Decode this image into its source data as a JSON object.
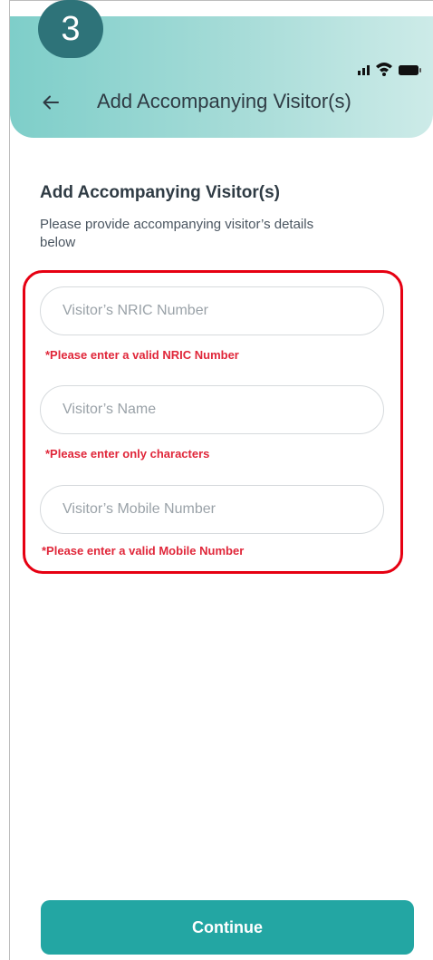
{
  "step": {
    "number": "3"
  },
  "status_bar": {
    "icons": [
      "signal-icon",
      "wifi-icon",
      "battery-icon"
    ]
  },
  "header": {
    "back_icon": "arrow-left-icon",
    "title": "Add Accompanying Visitor(s)"
  },
  "form": {
    "heading": "Add Accompanying Visitor(s)",
    "description": "Please provide accompanying visitor’s details below",
    "fields": [
      {
        "placeholder": "Visitor’s NRIC Number",
        "value": "",
        "error": "*Please enter a valid NRIC Number"
      },
      {
        "placeholder": "Visitor’s Name",
        "value": "",
        "error": "*Please enter only characters"
      },
      {
        "placeholder": "Visitor’s Mobile Number",
        "value": "",
        "error": "*Please enter a valid Mobile Number"
      }
    ]
  },
  "footer": {
    "continue_label": "Continue"
  },
  "colors": {
    "accent": "#23a6a3",
    "header_gradient_start": "#7ecec9",
    "step_badge": "#2e7379",
    "error": "#e0273a",
    "highlight_border": "#e60012"
  }
}
